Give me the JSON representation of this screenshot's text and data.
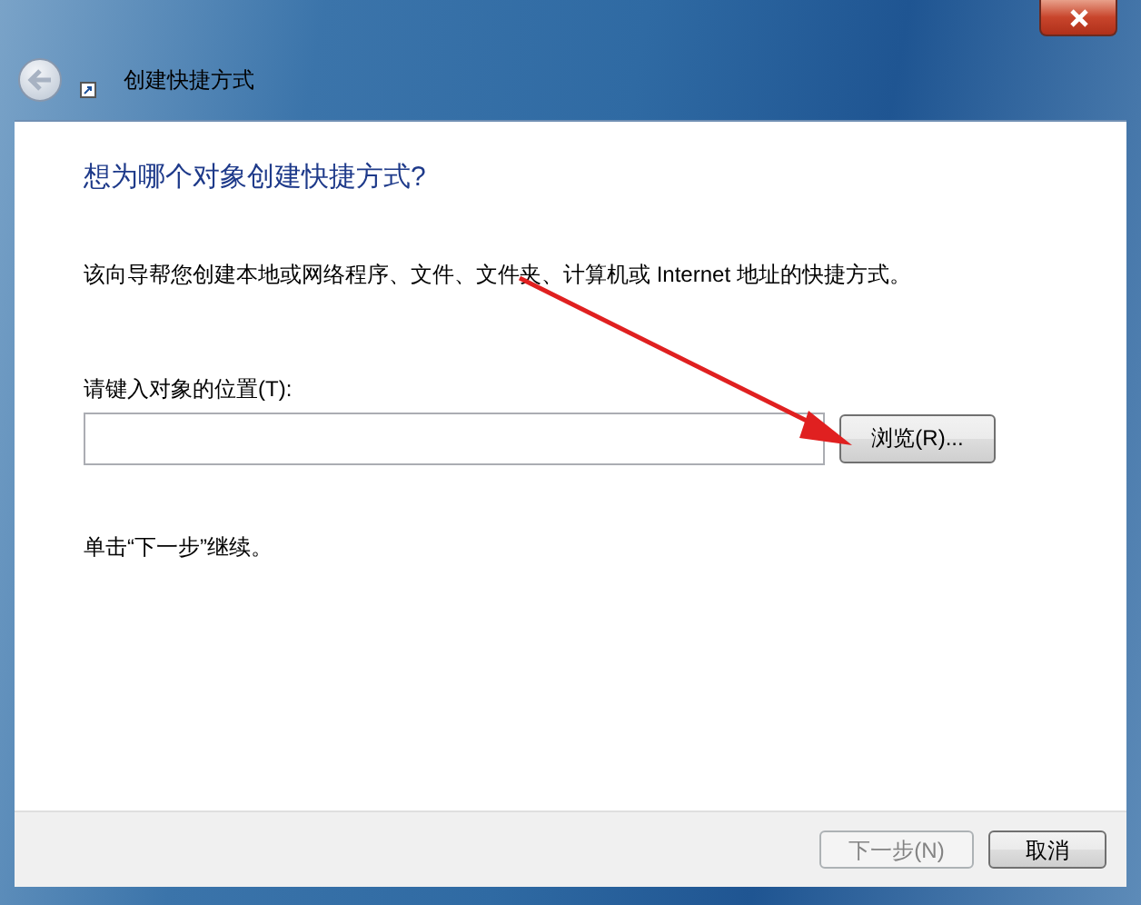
{
  "window": {
    "title": "创建快捷方式"
  },
  "heading": "想为哪个对象创建快捷方式?",
  "description": "该向导帮您创建本地或网络程序、文件、文件夹、计算机或 Internet 地址的快捷方式。",
  "location": {
    "label": "请键入对象的位置(T):",
    "browse_button": "浏览(R)..."
  },
  "hint": "单击“下一步”继续。",
  "buttons": [
    {
      "label": "下一步(N)",
      "disabled": true
    },
    {
      "label": "取消",
      "disabled": false
    }
  ]
}
